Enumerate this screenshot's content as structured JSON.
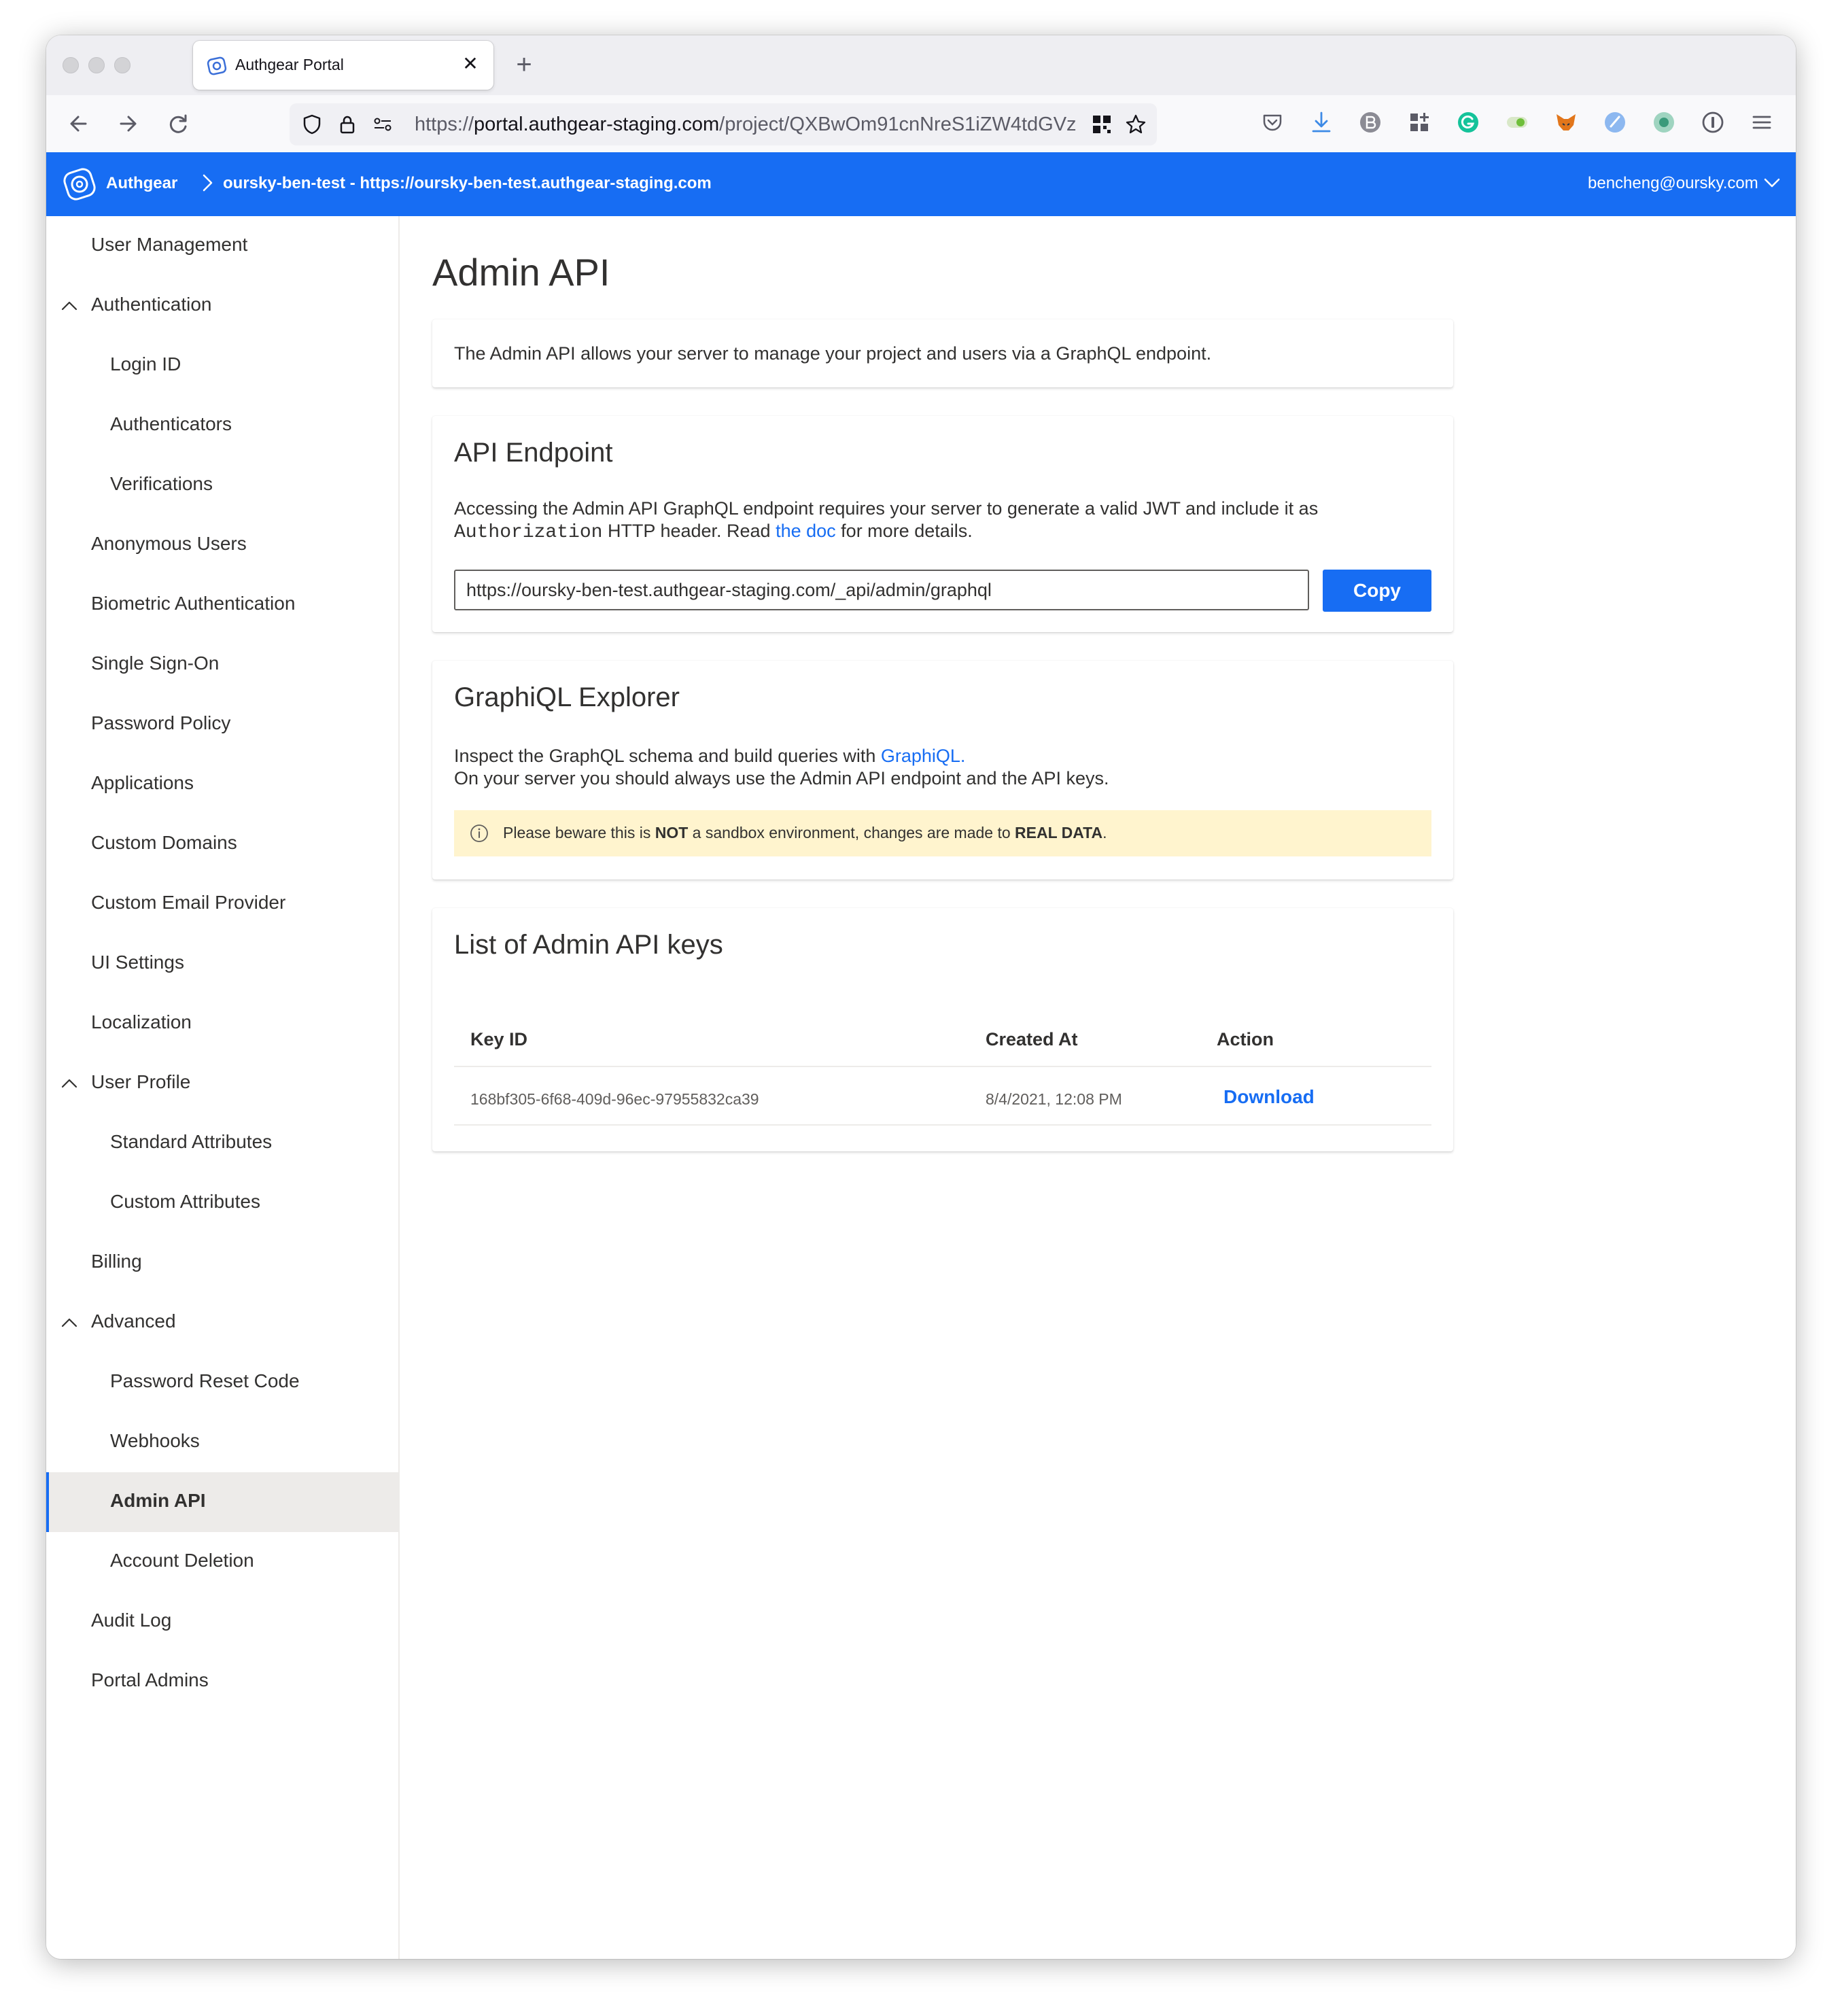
{
  "browser": {
    "tab_title": "Authgear Portal",
    "new_tab_symbol": "+",
    "close_symbol": "✕",
    "url_prefix": "https://",
    "url_host": "portal.authgear-staging.com",
    "url_path": "/project/QXBwOm91cnNreS1iZW4tdGVz"
  },
  "header": {
    "brand": "Authgear",
    "project": "oursky-ben-test - https://oursky-ben-test.authgear-staging.com",
    "user_email": "bencheng@oursky.com"
  },
  "sidebar": {
    "items": [
      {
        "label": "User Management",
        "level": 0
      },
      {
        "label": "Authentication",
        "level": 0,
        "expanded": true
      },
      {
        "label": "Login ID",
        "level": 1
      },
      {
        "label": "Authenticators",
        "level": 1
      },
      {
        "label": "Verifications",
        "level": 1
      },
      {
        "label": "Anonymous Users",
        "level": 0
      },
      {
        "label": "Biometric Authentication",
        "level": 0
      },
      {
        "label": "Single Sign-On",
        "level": 0
      },
      {
        "label": "Password Policy",
        "level": 0
      },
      {
        "label": "Applications",
        "level": 0
      },
      {
        "label": "Custom Domains",
        "level": 0
      },
      {
        "label": "Custom Email Provider",
        "level": 0
      },
      {
        "label": "UI Settings",
        "level": 0
      },
      {
        "label": "Localization",
        "level": 0
      },
      {
        "label": "User Profile",
        "level": 0,
        "expanded": true
      },
      {
        "label": "Standard Attributes",
        "level": 1
      },
      {
        "label": "Custom Attributes",
        "level": 1
      },
      {
        "label": "Billing",
        "level": 0
      },
      {
        "label": "Advanced",
        "level": 0,
        "expanded": true
      },
      {
        "label": "Password Reset Code",
        "level": 1
      },
      {
        "label": "Webhooks",
        "level": 1
      },
      {
        "label": "Admin API",
        "level": 1,
        "active": true
      },
      {
        "label": "Account Deletion",
        "level": 1
      },
      {
        "label": "Audit Log",
        "level": 0
      },
      {
        "label": "Portal Admins",
        "level": 0
      }
    ]
  },
  "page": {
    "title": "Admin API",
    "intro": "The Admin API allows your server to manage your project and users via a GraphQL endpoint."
  },
  "endpoint": {
    "title": "API Endpoint",
    "desc_line1": "Accessing the Admin API GraphQL endpoint requires your server to generate a valid JWT and include it as",
    "desc_code": "Authorization",
    "desc_mid": " HTTP header. Read ",
    "desc_link": "the doc",
    "desc_end": " for more details.",
    "url_value": "https://oursky-ben-test.authgear-staging.com/_api/admin/graphql",
    "copy_label": "Copy"
  },
  "explorer": {
    "title": "GraphiQL Explorer",
    "line1_pre": "Inspect the GraphQL schema and build queries with ",
    "line1_link": "GraphiQL.",
    "line2": "On your server you should always use the Admin API endpoint and the API keys.",
    "warning_pre": "Please beware this is ",
    "warning_bold1": "NOT",
    "warning_mid": " a sandbox environment, changes are made to ",
    "warning_bold2": "REAL DATA",
    "warning_end": "."
  },
  "keys": {
    "title": "List of Admin API keys",
    "columns": [
      "Key ID",
      "Created At",
      "Action"
    ],
    "rows": [
      {
        "key_id": "168bf305-6f68-409d-96ec-97955832ca39",
        "created_at": "8/4/2021, 12:08 PM",
        "action": "Download"
      }
    ]
  },
  "colors": {
    "accent": "#176df3",
    "warning_bg": "#fff4ce",
    "active_nav_bg": "#edebe9"
  }
}
